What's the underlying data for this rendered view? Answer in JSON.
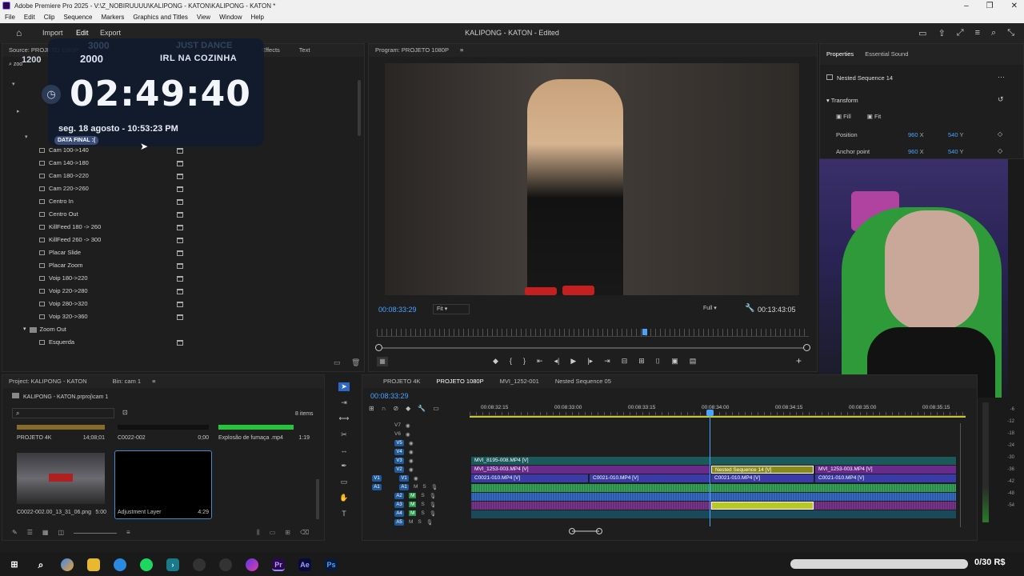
{
  "window": {
    "title": "Adobe Premiere Pro 2025 - V:\\Z_NOBIRUUUU\\KALIPONG - KATON\\KALIPONG - KATON *"
  },
  "menu": [
    "File",
    "Edit",
    "Clip",
    "Sequence",
    "Markers",
    "Graphics and Titles",
    "View",
    "Window",
    "Help"
  ],
  "header": {
    "import": "Import",
    "edit": "Edit",
    "export": "Export",
    "project_title": "KALIPONG - KATON - Edited"
  },
  "source_panel": {
    "tabs": [
      "Source: PROJETO 1080P",
      "Effects",
      "Text"
    ],
    "search_value": "zoo",
    "items": [
      {
        "label": "Cam 100->140"
      },
      {
        "label": "Cam 140->180"
      },
      {
        "label": "Cam 180->220"
      },
      {
        "label": "Cam 220->260"
      },
      {
        "label": "Centro In"
      },
      {
        "label": "Centro Out"
      },
      {
        "label": "KillFeed 180 -> 260"
      },
      {
        "label": "KillFeed 260 -> 300"
      },
      {
        "label": "Placar Slide"
      },
      {
        "label": "Placar Zoom"
      },
      {
        "label": "Voip 180->220"
      },
      {
        "label": "Voip 220->280"
      },
      {
        "label": "Voip 280->320"
      },
      {
        "label": "Voip 320->360"
      }
    ],
    "folder_zoom_out": "Zoom Out",
    "folder_zoom_out_item": "Esquerda"
  },
  "overlay": {
    "ghost1": "3000",
    "ghost2": "JUST DANCE",
    "small_left": "1200",
    "year": "2000",
    "subtitle": "IRL NA COZINHA",
    "timer": "02:49:40",
    "date": "seg. 18 agosto - 10:53:23 PM",
    "badge": "DATA FINAL :("
  },
  "program": {
    "tab": "Program: PROJETO 1080P",
    "timecode": "00:08:33:29",
    "fit": "Fit",
    "quality": "Full",
    "duration": "00:13:43:05"
  },
  "properties": {
    "tabs": [
      "Properties",
      "Essential Sound"
    ],
    "clip_name": "Nested Sequence 14",
    "transform": "Transform",
    "fill": "Fill",
    "fit": "Fit",
    "position_label": "Position",
    "position_x": "960",
    "position_y": "540",
    "anchor_label": "Anchor point",
    "anchor_x": "960",
    "anchor_y": "540",
    "x_lbl": "X",
    "y_lbl": "Y"
  },
  "project_panel": {
    "tab": "Project: KALIPONG - KATON",
    "bin_tab": "Bin: cam 1",
    "path": "KALIPONG - KATON.prproj\\cam 1",
    "items_count": "8 items",
    "items": [
      {
        "name": "PROJETO 4K",
        "meta": "14;08;01"
      },
      {
        "name": "C0022-002",
        "meta": "0;00"
      },
      {
        "name": "Explosão de fumaça .mp4",
        "meta": "1:19"
      },
      {
        "name": "C0022-002.00_13_31_06.png",
        "meta": "5:00"
      },
      {
        "name": "Adjustment Layer",
        "meta": "4:29"
      }
    ]
  },
  "timeline": {
    "tabs": [
      "PROJETO 4K",
      "PROJETO 1080P",
      "MVI_1252-001",
      "Nested Sequence 05"
    ],
    "timecode": "00:08:33:29",
    "ruler": [
      "00:08:32:15",
      "00:08:33:00",
      "00:08:33:15",
      "00:08:34:00",
      "00:08:34:15",
      "00:08:35:00",
      "00:08:35:15"
    ],
    "video_tracks": [
      "V7",
      "V6",
      "V5",
      "V4",
      "V3",
      "V2",
      "V1"
    ],
    "audio_tracks": [
      "A1",
      "A2",
      "A3",
      "A4",
      "A5"
    ],
    "clips": {
      "v3": "MVI_8195-008.MP4 [V]",
      "v2a": "MVI_1253-003.MP4 [V]",
      "v2b": "Nested Sequence 14 [V]",
      "v2c": "MVI_1253-003.MP4 [V]",
      "v1a": "C0021-010.MP4 [V]",
      "v1b": "C0021-010.MP4 [V]",
      "v1c": "C0021-010.MP4 [V]",
      "v1d": "C0021-010.MP4 [V]"
    },
    "meter_labels": [
      "-6",
      "-12",
      "-18",
      "-24",
      "-30",
      "-36",
      "-42",
      "-48",
      "-54"
    ]
  },
  "taskbar": {
    "balance": "0/30 R$"
  },
  "colors": {
    "accent": "#2d8ceb",
    "video_clip": "#3a3aa8",
    "audio_clip": "#2a8a4a",
    "nested": "#8a8a1a",
    "v2_clip": "#6a2a8a"
  }
}
